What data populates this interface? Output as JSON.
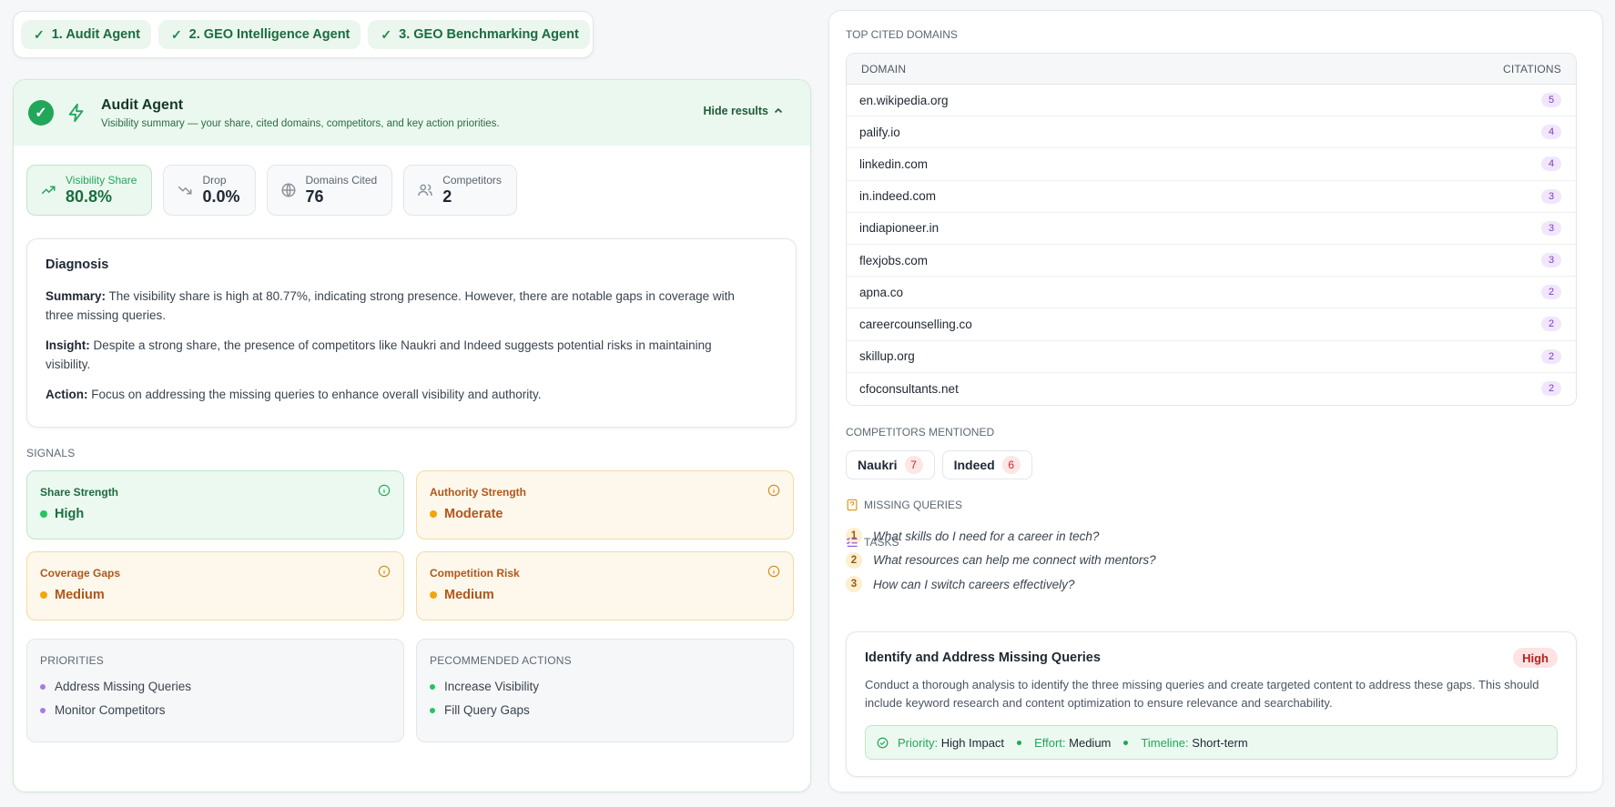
{
  "steps": [
    {
      "label": "1. Audit Agent"
    },
    {
      "label": "2. GEO Intelligence Agent"
    },
    {
      "label": "3. GEO Benchmarking Agent"
    }
  ],
  "audit": {
    "title": "Audit Agent",
    "subtitle": "Visibility summary — your share, cited domains, competitors, and key action priorities.",
    "hide_label": "Hide results",
    "metrics": [
      {
        "label": "Visibility Share",
        "value": "80.8%",
        "icon": "trending-up-icon"
      },
      {
        "label": "Drop",
        "value": "0.0%",
        "icon": "trending-down-icon"
      },
      {
        "label": "Domains Cited",
        "value": "76",
        "icon": "globe-icon"
      },
      {
        "label": "Competitors",
        "value": "2",
        "icon": "users-icon"
      }
    ],
    "diagnosis": {
      "title": "Diagnosis",
      "summary_label": "Summary:",
      "summary": " The visibility share is high at 80.77%, indicating strong presence. However, there are notable gaps in coverage with three missing queries.",
      "insight_label": "Insight:",
      "insight": " Despite a strong share, the presence of competitors like Naukri and Indeed suggests potential risks in maintaining visibility.",
      "action_label": "Action:",
      "action": " Focus on addressing the missing queries to enhance overall visibility and authority."
    },
    "signals_label": "SIGNALS",
    "signals": [
      {
        "name": "Share Strength",
        "level": "High",
        "tone": "green"
      },
      {
        "name": "Authority Strength",
        "level": "Moderate",
        "tone": "amber"
      },
      {
        "name": "Coverage Gaps",
        "level": "Medium",
        "tone": "amber"
      },
      {
        "name": "Competition Risk",
        "level": "Medium",
        "tone": "amber"
      }
    ],
    "priorities": {
      "title": "PRIORITIES",
      "items": [
        "Address Missing Queries",
        "Monitor Competitors"
      ]
    },
    "recommended": {
      "title": "PECOMMENDED ACTIONS",
      "items": [
        "Increase Visibility",
        "Fill Query Gaps"
      ]
    }
  },
  "domains": {
    "title": "TOP CITED DOMAINS",
    "col_domain": "DOMAIN",
    "col_citations": "CITATIONS",
    "rows": [
      {
        "domain": "en.wikipedia.org",
        "count": "5"
      },
      {
        "domain": "palify.io",
        "count": "4"
      },
      {
        "domain": "linkedin.com",
        "count": "4"
      },
      {
        "domain": "in.indeed.com",
        "count": "3"
      },
      {
        "domain": "indiapioneer.in",
        "count": "3"
      },
      {
        "domain": "flexjobs.com",
        "count": "3"
      },
      {
        "domain": "apna.co",
        "count": "2"
      },
      {
        "domain": "careercounselling.co",
        "count": "2"
      },
      {
        "domain": "skillup.org",
        "count": "2"
      },
      {
        "domain": "cfoconsultants.net",
        "count": "2"
      }
    ]
  },
  "competitors": {
    "title": "COMPETITORS MENTIONED",
    "items": [
      {
        "name": "Naukri",
        "count": "7"
      },
      {
        "name": "Indeed",
        "count": "6"
      }
    ]
  },
  "missing_queries": {
    "title": "MISSING QUERIES",
    "items": [
      {
        "num": "1",
        "text": "What skills do I need for a career in tech?"
      },
      {
        "num": "2",
        "text": "What resources can help me connect with mentors?"
      },
      {
        "num": "3",
        "text": "How can I switch careers effectively?"
      }
    ]
  },
  "tasks": {
    "title": "TASKS",
    "card": {
      "title": "Identify and Address Missing Queries",
      "priority_badge": "High",
      "description": "Conduct a thorough analysis to identify the three missing queries and create targeted content to address these gaps. This should include keyword research and content optimization to ensure relevance and searchability.",
      "priority_label": "Priority:",
      "priority_value": "High Impact",
      "effort_label": "Effort:",
      "effort_value": "Medium",
      "timeline_label": "Timeline:",
      "timeline_value": "Short-term"
    }
  },
  "colors": {
    "accent_green": "#22a65a",
    "amber": "#f1a60c",
    "purple": "#7b3fc7",
    "red": "#c72b2b"
  }
}
